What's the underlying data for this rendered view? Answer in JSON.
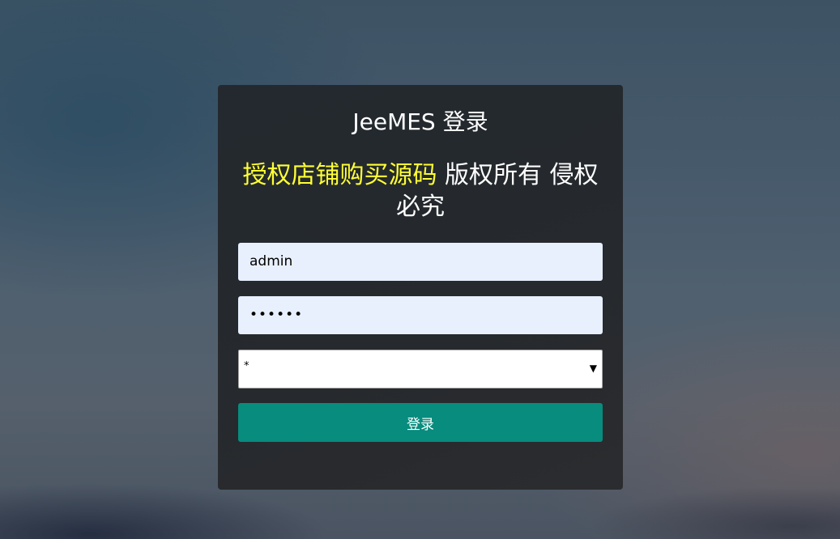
{
  "colors": {
    "card_bg": "#26292d",
    "highlight_text": "#ffff33",
    "button_bg": "#078c7e",
    "input_bg": "#e8f0fe"
  },
  "login": {
    "title": "JeeMES 登录",
    "notice_highlight": "授权店铺购买源码",
    "notice_rest": " 版权所有 侵权必究",
    "username_value": "admin",
    "password_value": "••••••",
    "select_value": "*",
    "select_arrow_icon": "caret-down-icon",
    "submit_label": "登录"
  }
}
